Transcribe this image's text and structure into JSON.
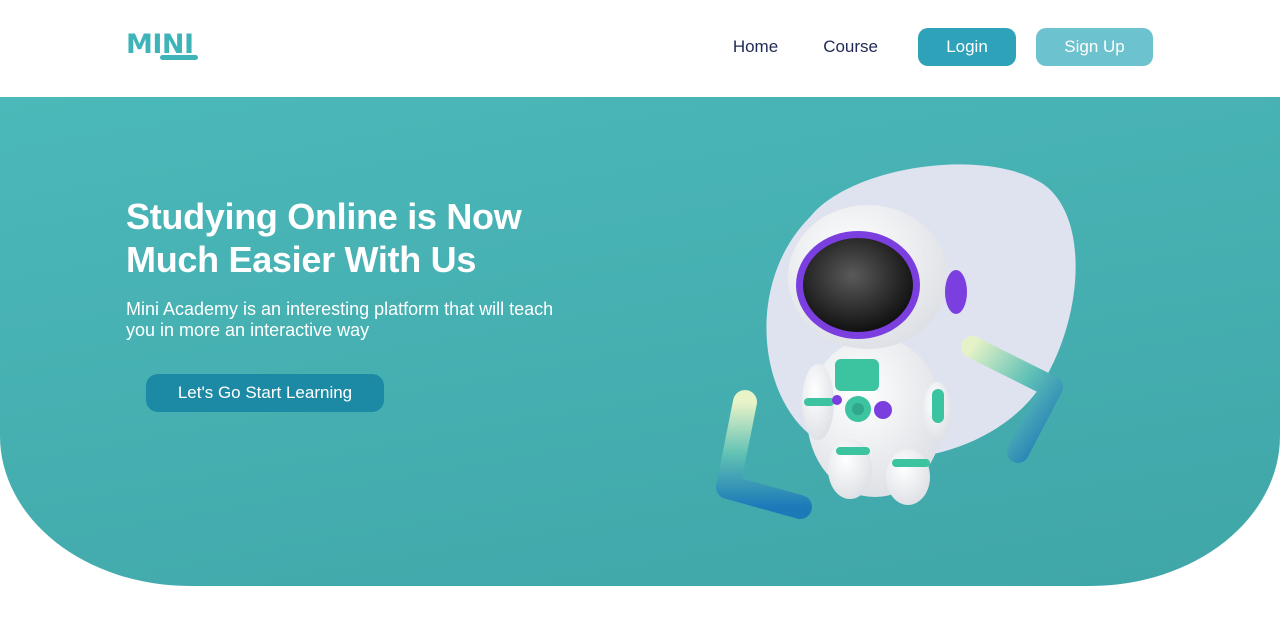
{
  "brand": {
    "logo_text": "MINI"
  },
  "nav": {
    "links": [
      {
        "label": "Home"
      },
      {
        "label": "Course"
      }
    ],
    "login_label": "Login",
    "signup_label": "Sign Up"
  },
  "hero": {
    "title": "Studying Online is Now Much Easier With Us",
    "description": "Mini Academy is an interesting platform that will teach you in more an interactive way",
    "cta_label": "Let's Go Start Learning",
    "illustration_icon": "astronaut-code-brackets-illustration"
  },
  "colors": {
    "brand": "#3fb4b8",
    "hero_bg": "#45b0b1",
    "login_bg": "#2ea2b8",
    "signup_bg": "#6cc2cf",
    "cta_bg": "#1d8aa5",
    "nav_text": "#1f2a55"
  }
}
